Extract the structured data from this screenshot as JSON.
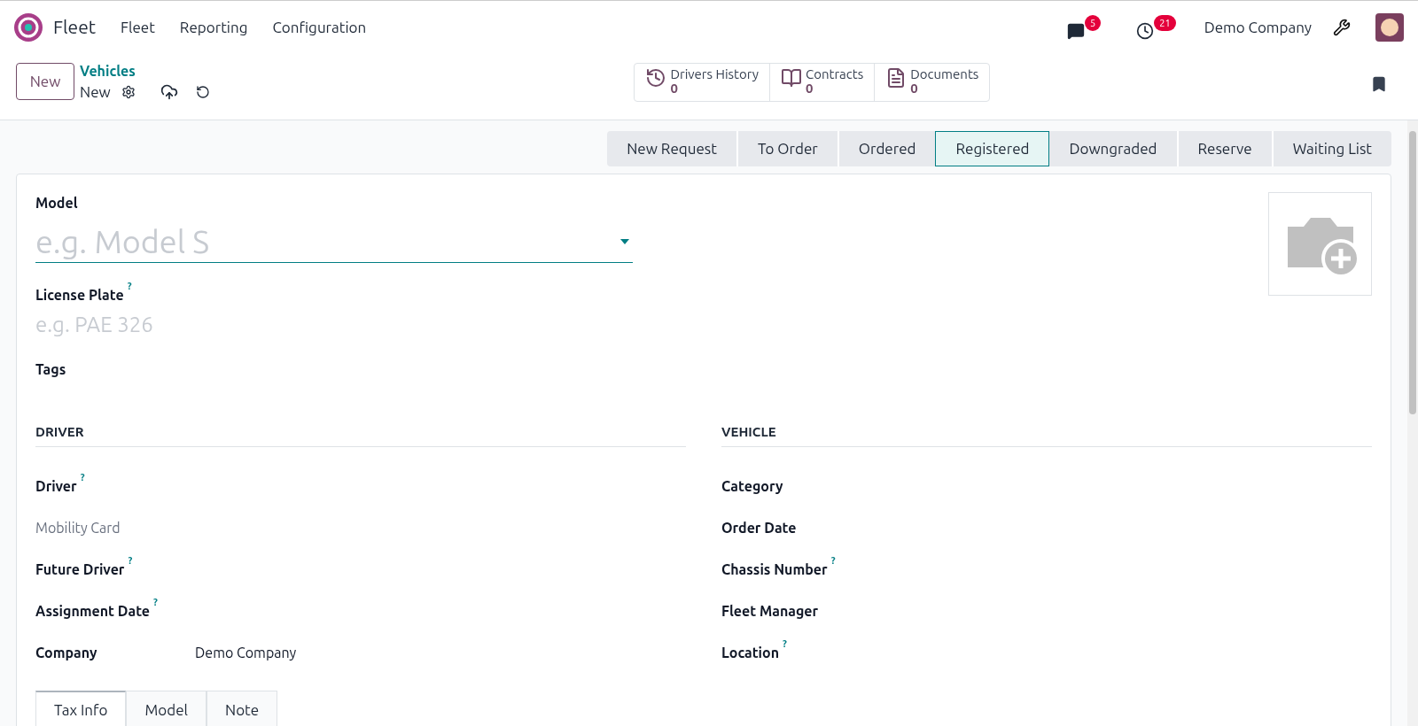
{
  "navbar": {
    "app_name": "Fleet",
    "menu": [
      "Fleet",
      "Reporting",
      "Configuration"
    ],
    "messages_badge": "5",
    "activities_badge": "21",
    "company": "Demo Company"
  },
  "control_panel": {
    "new_button": "New",
    "breadcrumb": "Vehicles",
    "record": "New",
    "smart_buttons": [
      {
        "kind": "history",
        "label": "Drivers History",
        "count": "0"
      },
      {
        "kind": "contracts",
        "label": "Contracts",
        "count": "0"
      },
      {
        "kind": "documents",
        "label": "Documents",
        "count": "0"
      }
    ]
  },
  "stages": [
    {
      "label": "New Request",
      "selected": false
    },
    {
      "label": "To Order",
      "selected": false
    },
    {
      "label": "Ordered",
      "selected": false
    },
    {
      "label": "Registered",
      "selected": true
    },
    {
      "label": "Downgraded",
      "selected": false
    },
    {
      "label": "Reserve",
      "selected": false
    },
    {
      "label": "Waiting List",
      "selected": false
    }
  ],
  "form": {
    "model": {
      "label": "Model",
      "placeholder": "e.g. Model S"
    },
    "license_plate": {
      "label": "License Plate",
      "help": "?",
      "placeholder": "e.g. PAE 326"
    },
    "tags": {
      "label": "Tags"
    },
    "driver_section": {
      "title": "DRIVER",
      "fields": [
        {
          "label": "Driver",
          "help": "?",
          "dimmed": false
        },
        {
          "label": "Mobility Card",
          "dimmed": true
        },
        {
          "label": "Future Driver",
          "help": "?",
          "dimmed": false
        },
        {
          "label": "Assignment Date",
          "help": "?",
          "dimmed": false
        },
        {
          "label": "Company",
          "value": "Demo Company",
          "dimmed": false
        }
      ]
    },
    "vehicle_section": {
      "title": "VEHICLE",
      "fields": [
        {
          "label": "Category",
          "dimmed": false
        },
        {
          "label": "Order Date",
          "dimmed": false
        },
        {
          "label": "Chassis Number",
          "help": "?",
          "dimmed": false
        },
        {
          "label": "Fleet Manager",
          "dimmed": false
        },
        {
          "label": "Location",
          "help": "?",
          "dimmed": false
        }
      ]
    },
    "tabs": [
      {
        "label": "Tax Info",
        "selected": true
      },
      {
        "label": "Model",
        "selected": false
      },
      {
        "label": "Note",
        "selected": false
      }
    ]
  }
}
